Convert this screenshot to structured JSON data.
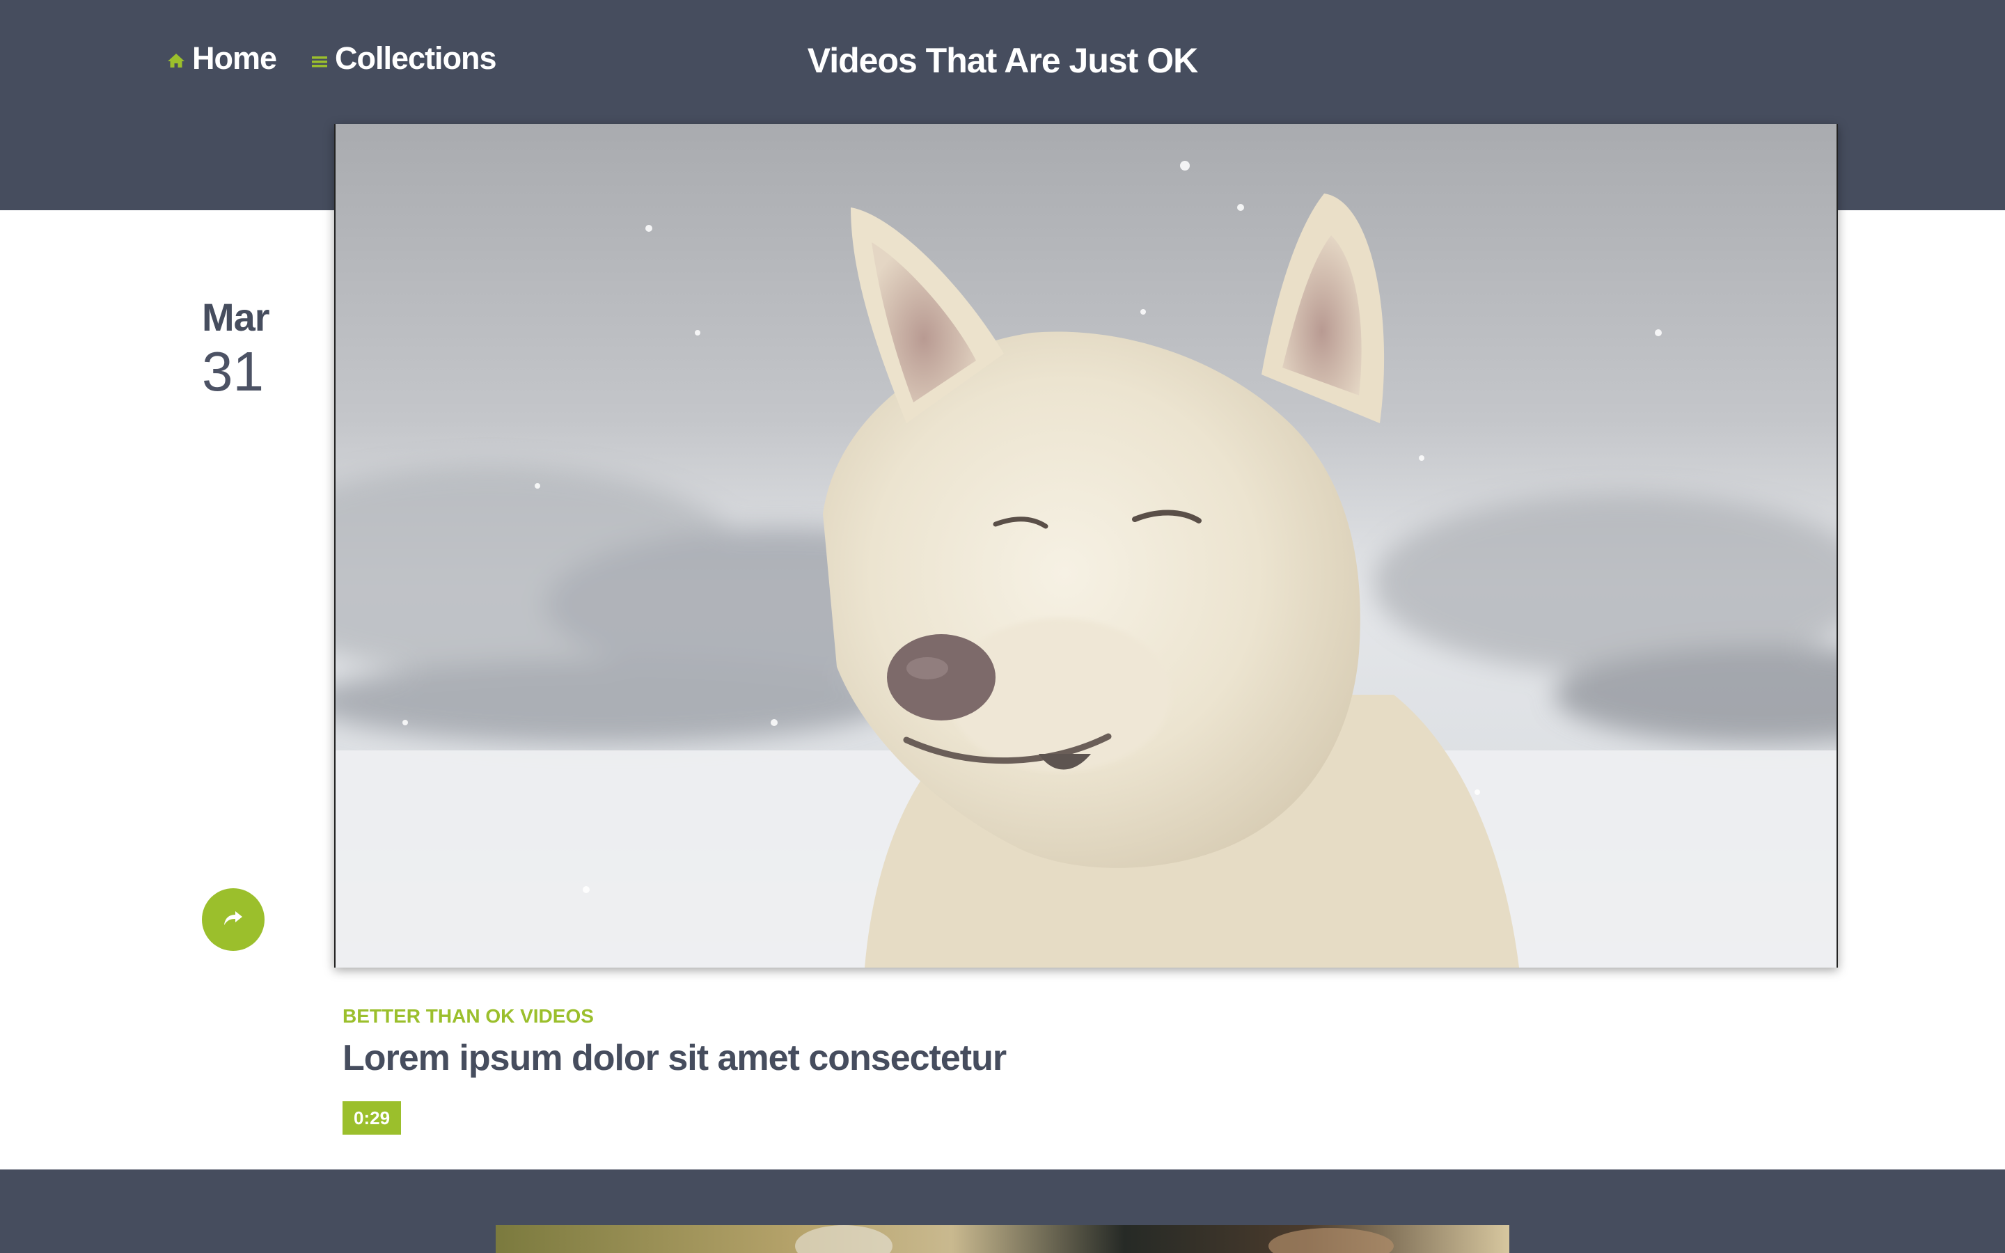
{
  "nav": {
    "home_label": "Home",
    "home_icon": "home-icon",
    "collections_label": "Collections",
    "collections_icon": "menu-icon"
  },
  "site_title": "Videos That Are Just OK",
  "post": {
    "date_month": "Mar",
    "date_day": "31",
    "category": "BETTER THAN OK VIDEOS",
    "title": "Lorem ipsum dolor sit amet consectetur",
    "duration": "0:29",
    "share_icon": "share-icon"
  },
  "colors": {
    "header_bg": "#464d5e",
    "accent": "#9bbf2c",
    "text_dark": "#464d5e",
    "page_bg": "#ffffff"
  }
}
